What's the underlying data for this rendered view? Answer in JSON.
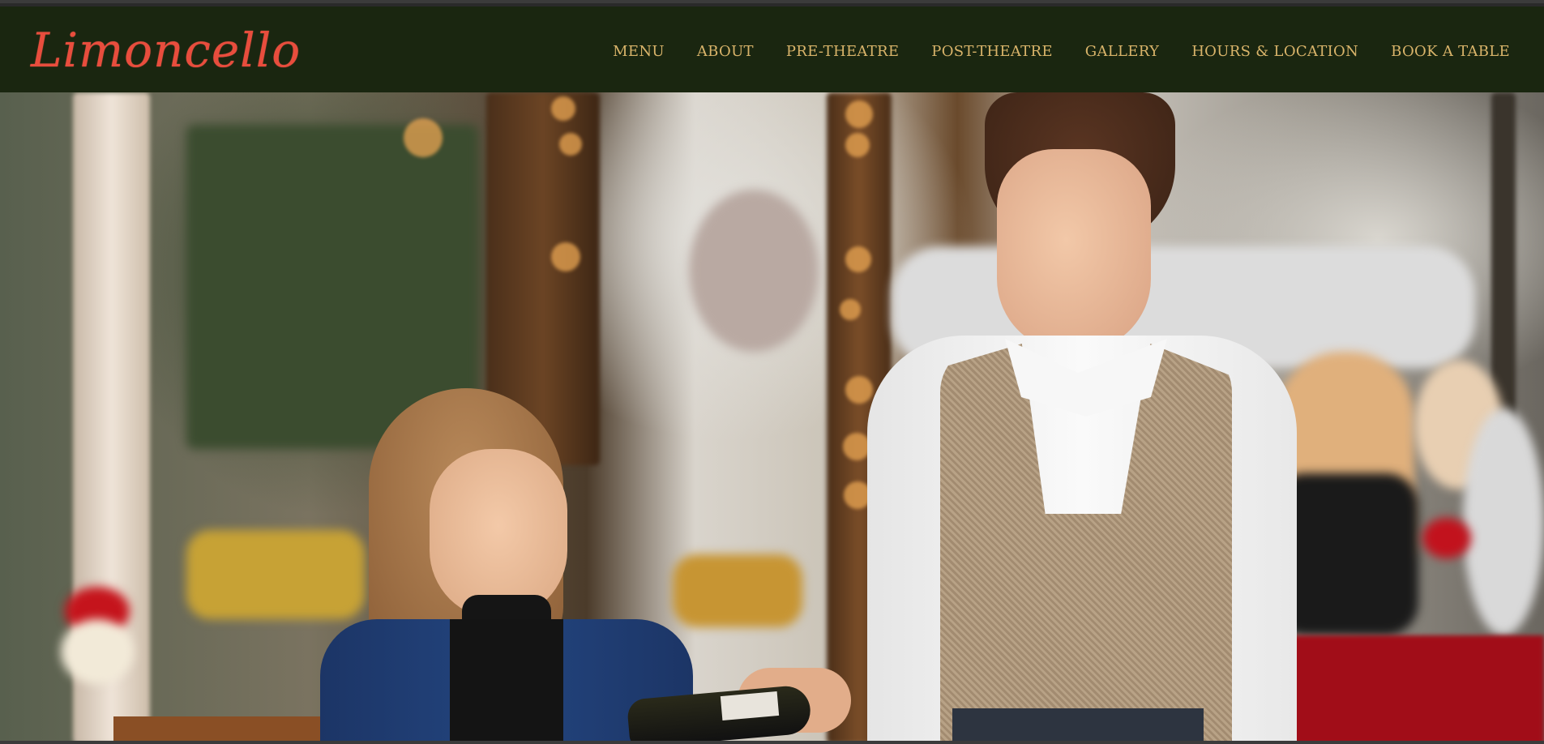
{
  "brand": {
    "name": "Limoncello"
  },
  "nav": {
    "items": [
      {
        "label": "MENU"
      },
      {
        "label": "ABOUT"
      },
      {
        "label": "PRE-THEATRE"
      },
      {
        "label": "POST-THEATRE"
      },
      {
        "label": "GALLERY"
      },
      {
        "label": "HOURS & LOCATION"
      },
      {
        "label": "BOOK A TABLE"
      }
    ]
  },
  "colors": {
    "header_background": "#1a2610",
    "logo": "#e84d3d",
    "nav_text": "#d9b46a"
  },
  "hero": {
    "image": "waitress-serving-wine-to-guest-photo"
  }
}
